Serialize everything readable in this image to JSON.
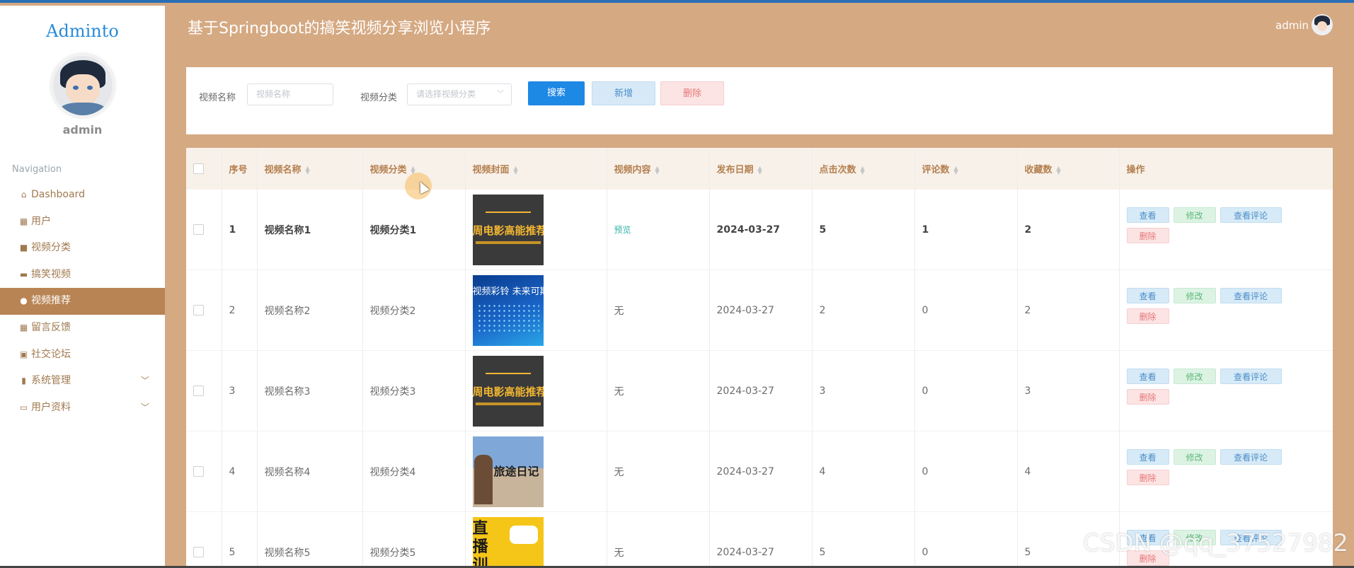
{
  "brand": "Adminto",
  "sidebar": {
    "username": "admin",
    "nav_title": "Navigation",
    "items": [
      {
        "label": "Dashboard",
        "icon": "home-icon",
        "glyph": "⌂"
      },
      {
        "label": "用户",
        "icon": "grid-icon",
        "glyph": "▦"
      },
      {
        "label": "视频分类",
        "icon": "bookmark-icon",
        "glyph": "■"
      },
      {
        "label": "搞笑视频",
        "icon": "film-icon",
        "glyph": "▬"
      },
      {
        "label": "视频推荐",
        "icon": "user-icon",
        "glyph": "●",
        "active": true
      },
      {
        "label": "留言反馈",
        "icon": "grid-icon",
        "glyph": "▦"
      },
      {
        "label": "社交论坛",
        "icon": "clipboard-icon",
        "glyph": "▣"
      },
      {
        "label": "系统管理",
        "icon": "bar-chart-icon",
        "glyph": "▮",
        "expandable": true
      },
      {
        "label": "用户资料",
        "icon": "folder-icon",
        "glyph": "▭",
        "expandable": true
      }
    ]
  },
  "header": {
    "title": "基于Springboot的搞笑视频分享浏览小程序",
    "user": "admin"
  },
  "search": {
    "name_label": "视频名称",
    "name_placeholder": "视频名称",
    "category_label": "视频分类",
    "category_placeholder": "请选择视频分类",
    "search_btn": "搜索",
    "add_btn": "新增",
    "delete_btn": "删除"
  },
  "table": {
    "headers": [
      "序号",
      "视频名称",
      "视频分类",
      "视频封面",
      "视频内容",
      "发布日期",
      "点击次数",
      "评论数",
      "收藏数",
      "操作"
    ],
    "rows": [
      {
        "idx": "1",
        "name": "视频名称1",
        "category": "视频分类1",
        "cover": "dark",
        "cover_text": "周电影高能推荐",
        "content": "预览",
        "date": "2024-03-27",
        "clicks": "5",
        "comments": "1",
        "favorites": "2"
      },
      {
        "idx": "2",
        "name": "视频名称2",
        "category": "视频分类2",
        "cover": "blue",
        "cover_text": "视频彩铃 未来可期",
        "content": "无",
        "date": "2024-03-27",
        "clicks": "2",
        "comments": "0",
        "favorites": "2"
      },
      {
        "idx": "3",
        "name": "视频名称3",
        "category": "视频分类3",
        "cover": "dark",
        "cover_text": "周电影高能推荐",
        "content": "无",
        "date": "2024-03-27",
        "clicks": "3",
        "comments": "0",
        "favorites": "3"
      },
      {
        "idx": "4",
        "name": "视频名称4",
        "category": "视频分类4",
        "cover": "travel",
        "cover_text": "旅途日记",
        "content": "无",
        "date": "2024-03-27",
        "clicks": "4",
        "comments": "0",
        "favorites": "4"
      },
      {
        "idx": "5",
        "name": "视频名称5",
        "category": "视频分类5",
        "cover": "yellow",
        "cover_text": "直播训营",
        "content": "无",
        "date": "2024-03-27",
        "clicks": "5",
        "comments": "0",
        "favorites": "5"
      }
    ],
    "actions": {
      "view": "查看",
      "edit": "修改",
      "comments": "查看评论",
      "delete": "删除"
    }
  },
  "watermark": "CSDN @qq_37527982"
}
